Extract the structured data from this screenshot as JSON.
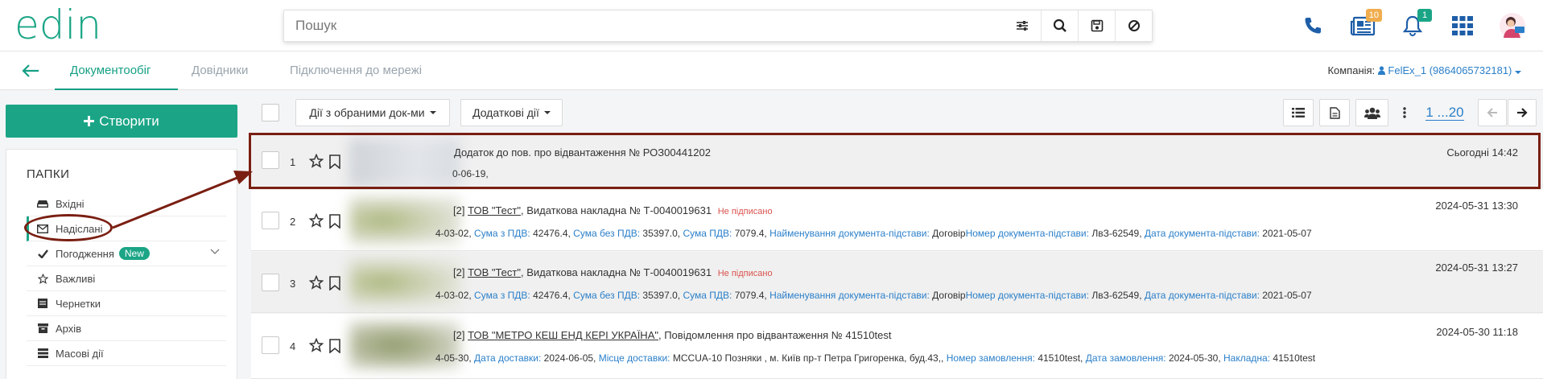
{
  "header": {
    "logo": "edin",
    "search_placeholder": "Пошук",
    "notifications": {
      "news_count": "10",
      "bell_count": "1"
    }
  },
  "nav": {
    "tabs": [
      "Документообіг",
      "Довідники",
      "Підключення до мережі"
    ],
    "company_label": "Компанія:",
    "company_value": "FelEx_1 (9864065732181)"
  },
  "sidebar": {
    "create_label": "Створити",
    "folders_title": "ПАПКИ",
    "folders": [
      {
        "label": "Вхідні"
      },
      {
        "label": "Надіслані"
      },
      {
        "label": "Погодження",
        "badge": "New"
      },
      {
        "label": "Важливі"
      },
      {
        "label": "Чернетки"
      },
      {
        "label": "Архів"
      },
      {
        "label": "Масові дії"
      }
    ]
  },
  "toolbar": {
    "actions_selected": "Дії з обраними док-ми",
    "extra_actions": "Додаткові дії",
    "pager": "1 ...20"
  },
  "documents": [
    {
      "num": "1",
      "title": "Додаток до пов. про відвантаження № РОЗ00441202",
      "meta": "0-06-19,",
      "date": "Сьогодні 14:42"
    },
    {
      "num": "2",
      "prefix": "[2]",
      "company": "ТОВ \"Тест\"",
      "title": ", Видаткова накладна № Т-0040019631",
      "status": "Не підписано",
      "meta_start": "4-03-02,",
      "meta": [
        {
          "k": "Сума з ПДВ:",
          "v": "42476.4,"
        },
        {
          "k": "Сума без ПДВ:",
          "v": "35397.0,"
        },
        {
          "k": "Сума ПДВ:",
          "v": "7079.4,"
        },
        {
          "k": "Найменування документа-підстави:",
          "v": "Договір"
        },
        {
          "k": "Номер документа-підстави:",
          "v": "ЛвЗ-62549,"
        },
        {
          "k": "Дата документа-підстави:",
          "v": "2021-05-07"
        }
      ],
      "date": "2024-05-31 13:30"
    },
    {
      "num": "3",
      "prefix": "[2]",
      "company": "ТОВ \"Тест\"",
      "title": ", Видаткова накладна № Т-0040019631",
      "status": "Не підписано",
      "meta_start": "4-03-02,",
      "meta": [
        {
          "k": "Сума з ПДВ:",
          "v": "42476.4,"
        },
        {
          "k": "Сума без ПДВ:",
          "v": "35397.0,"
        },
        {
          "k": "Сума ПДВ:",
          "v": "7079.4,"
        },
        {
          "k": "Найменування документа-підстави:",
          "v": "Договір"
        },
        {
          "k": "Номер документа-підстави:",
          "v": "ЛвЗ-62549,"
        },
        {
          "k": "Дата документа-підстави:",
          "v": "2021-05-07"
        }
      ],
      "date": "2024-05-31 13:27"
    },
    {
      "num": "4",
      "prefix": "[2]",
      "company": "ТОВ \"МЕТРО КЕШ ЕНД КЕРІ УКРАЇНА\"",
      "title": ", Повідомлення про відвантаження № 41510test",
      "meta_start": "4-05-30,",
      "meta": [
        {
          "k": "Дата доставки:",
          "v": "2024-06-05,"
        },
        {
          "k": "Місце доставки:",
          "v": "MCCUA-10 Позняки , м. Київ пр-т Петра Григоренка, буд.43,,"
        },
        {
          "k": "Номер замовлення:",
          "v": "41510test,"
        },
        {
          "k": "Дата замовлення:",
          "v": "2024-05-30,"
        },
        {
          "k": "Накладна:",
          "v": "41510test"
        }
      ],
      "date": "2024-05-30 11:18"
    }
  ],
  "colors": {
    "brand": "#1ba586",
    "link": "#2a7fc9",
    "annotation": "#7a1e12"
  }
}
